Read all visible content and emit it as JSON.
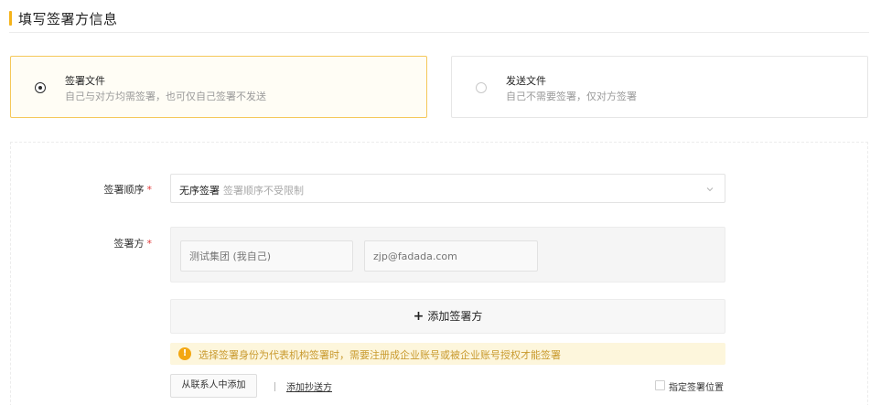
{
  "section": {
    "title": "填写签署方信息"
  },
  "options": [
    {
      "title": "签署文件",
      "desc": "自己与对方均需签署，也可仅自己签署不发送",
      "selected": true
    },
    {
      "title": "发送文件",
      "desc": "自己不需要签署，仅对方签署",
      "selected": false
    }
  ],
  "form": {
    "order_label": "签署顺序",
    "order_value": "无序签署",
    "order_hint": "签署顺序不受限制",
    "signer_label": "签署方",
    "required_mark": "*",
    "signer_name_placeholder": "测试集团 (我自己)",
    "signer_email_placeholder": "zjp@fadada.com",
    "add_signer_label": "添加签署方",
    "add_signer_plus": "+",
    "notice_icon": "!",
    "notice_text": "选择签署身份为代表机构签署时，需要注册成企业账号或被企业账号授权才能签署",
    "contacts_button": "从联系人中添加",
    "cc_link": "添加抄送方",
    "position_checkbox_label": "指定签署位置"
  },
  "colors": {
    "accent": "#f5b31a",
    "selected_border": "#f5c85a",
    "required": "#e23b3b",
    "notice_bg": "#fdf6dc",
    "notice_text": "#c99a2e"
  }
}
